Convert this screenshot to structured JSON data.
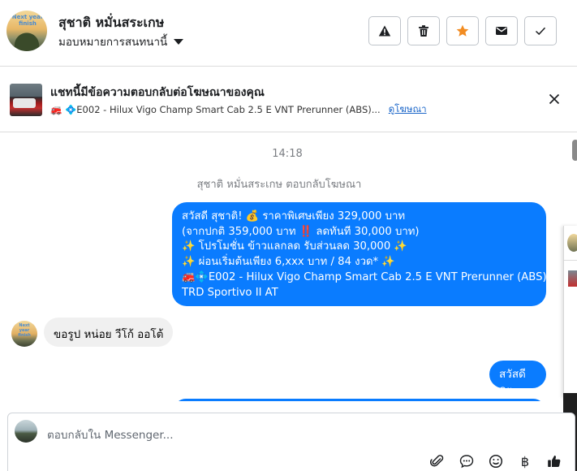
{
  "header": {
    "avatar_text": "Next year finish",
    "name": "สุชาติ หมั่นสระเกษ",
    "assign_label": "มอบหมายการสนทนานี้",
    "buttons": [
      "report-icon",
      "trash-icon",
      "star-icon",
      "mail-icon",
      "check-icon"
    ],
    "star_color": "#f28c22"
  },
  "ad_banner": {
    "title": "แชทนี้มีข้อความตอบกลับต่อโฆษณาของคุณ",
    "product": "🚒 💠E002 - Hilux Vigo Champ Smart Cab 2.5 E VNT Prerunner (ABS)...",
    "view_ad": "ดูโฆษณา"
  },
  "chat": {
    "timestamp": "14:18",
    "replied_note": "สุชาติ หมั่นสระเกษ ตอบกลับโฆษณา",
    "outgoing_1": [
      "สวัสดี สุชาติ! 💰 ราคาพิเศษเพียง 329,000 บาท",
      "(จากปกติ 359,000 บาท ‼️ ลดทันที 30,000 บาท)",
      "✨ โปรโมชั่น ข้าวแลกลด รับส่วนลด 30,000 ✨",
      "✨ ผ่อนเริ่มต้นเพียง 6,xxx บาท / 84 งวด* ✨",
      "🚒💠E002 - Hilux Vigo Champ Smart Cab 2.5 E VNT Prerunner (ABS)",
      "TRD Sportivo II AT"
    ],
    "incoming_1": "ขอรูป หน่อย วีโก้ ออโต้",
    "outgoing_2": "สวัสดีคะ",
    "accent_color": "#0a7cff"
  },
  "composer": {
    "placeholder": "ตอบกลับใน Messenger...",
    "tools": [
      "attachment-icon",
      "saved-reply-icon",
      "emoji-icon",
      "currency-icon",
      "like-icon"
    ],
    "currency_symbol": "฿"
  }
}
